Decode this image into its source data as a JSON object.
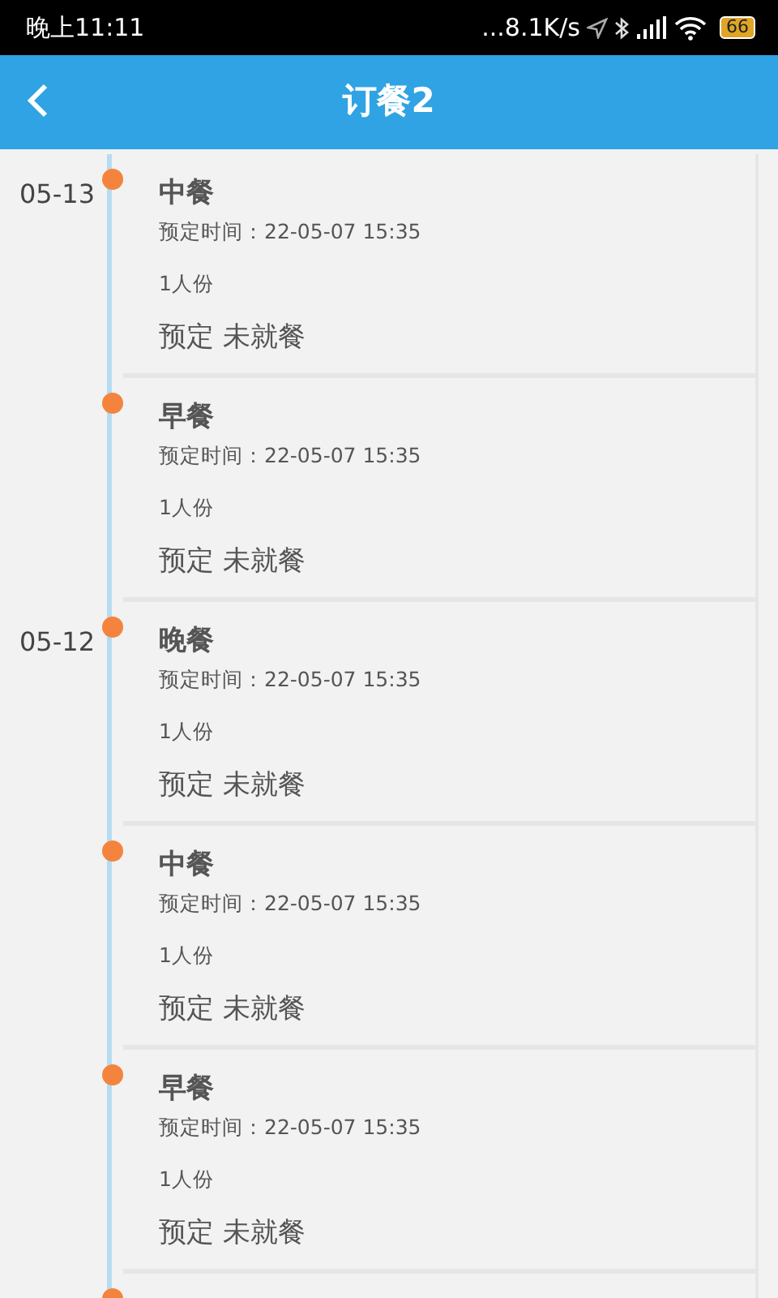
{
  "status_bar": {
    "time": "晚上11:11",
    "speed": "...8.1K/s",
    "battery": "66"
  },
  "app_bar": {
    "title": "订餐2"
  },
  "groups": [
    {
      "date": "05-13",
      "meals": [
        {
          "name": "中餐",
          "time": "预定时间：22-05-07 15:35",
          "portion": "1人份",
          "status": "预定 未就餐"
        },
        {
          "name": "早餐",
          "time": "预定时间：22-05-07 15:35",
          "portion": "1人份",
          "status": "预定 未就餐"
        }
      ]
    },
    {
      "date": "05-12",
      "meals": [
        {
          "name": "晚餐",
          "time": "预定时间：22-05-07 15:35",
          "portion": "1人份",
          "status": "预定 未就餐"
        },
        {
          "name": "中餐",
          "time": "预定时间：22-05-07 15:35",
          "portion": "1人份",
          "status": "预定 未就餐"
        },
        {
          "name": "早餐",
          "time": "预定时间：22-05-07 15:35",
          "portion": "1人份",
          "status": "预定 未就餐"
        }
      ]
    }
  ]
}
